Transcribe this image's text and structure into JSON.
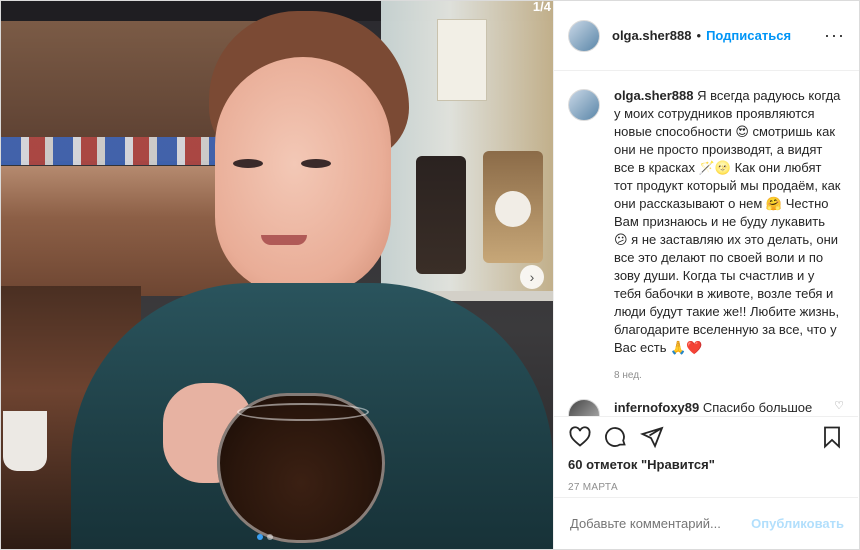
{
  "post": {
    "carousel_count": "1/4",
    "carousel_dots": 2,
    "active_dot": 0
  },
  "header": {
    "username": "olga.sher888",
    "bullet": "•",
    "follow_label": "Подписаться",
    "more_icon": "more-horizontal-icon"
  },
  "caption": {
    "username": "olga.sher888",
    "text": "Я всегда радуюсь когда у моих сотрудников проявляются новые способности 😍 смотришь как они не просто производят, а видят все в красках 🪄🌝 Как они любят тот продукт который мы продаём, как они рассказывают о нем 🤗 Честно Вам признаюсь и не буду лукавить 😕 я не заставляю их это делать, они все это делают по своей воли и по зову души. Когда ты счастлив и у тебя бабочки в животе, возле тебя и люди будут такие же!! Любите жизнь, благодарите вселенную за все, что у Вас есть 🙏❤️",
    "age": "8 нед."
  },
  "comments": [
    {
      "username": "infernofoxy89",
      "text": "Спасибо большое"
    }
  ],
  "actions": {
    "likes_text": "60 отметок \"Нравится\"",
    "date": "27 МАРТА",
    "icons": [
      "heart-icon",
      "comment-icon",
      "share-icon",
      "bookmark-icon"
    ]
  },
  "add_comment": {
    "placeholder": "Добавьте комментарий...",
    "publish_label": "Опубликовать"
  },
  "colors": {
    "accent": "#0095f6",
    "publish_disabled": "#b2dffc",
    "muted": "#8e8e8e"
  }
}
